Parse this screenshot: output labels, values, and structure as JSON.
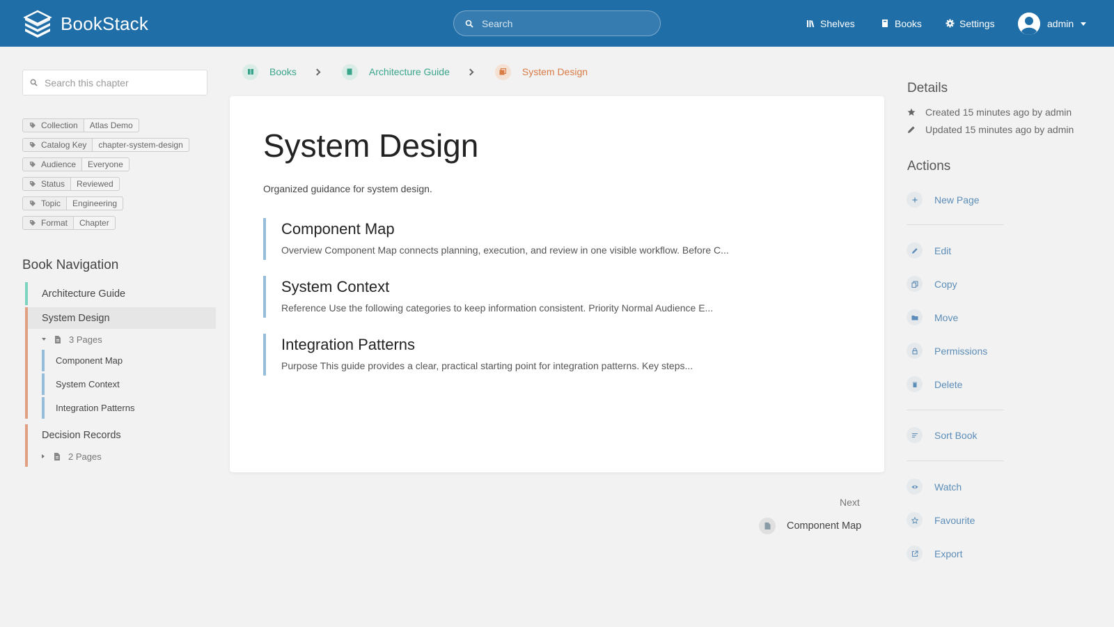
{
  "header": {
    "app_name": "BookStack",
    "search_placeholder": "Search",
    "nav": [
      {
        "label": "Shelves",
        "icon": "shelves-icon"
      },
      {
        "label": "Books",
        "icon": "book-icon"
      },
      {
        "label": "Settings",
        "icon": "gear-icon"
      }
    ],
    "user_name": "admin"
  },
  "left_sidebar": {
    "search_placeholder": "Search this chapter",
    "tags": [
      {
        "name": "Collection",
        "value": "Atlas Demo"
      },
      {
        "name": "Catalog Key",
        "value": "chapter-system-design"
      },
      {
        "name": "Audience",
        "value": "Everyone"
      },
      {
        "name": "Status",
        "value": "Reviewed"
      },
      {
        "name": "Topic",
        "value": "Engineering"
      },
      {
        "name": "Format",
        "value": "Chapter"
      }
    ],
    "book_navigation_title": "Book Navigation",
    "book": "Architecture Guide",
    "chapters": [
      {
        "name": "System Design",
        "pages_label": "3 Pages",
        "expanded": true,
        "pages": [
          "Component Map",
          "System Context",
          "Integration Patterns"
        ]
      },
      {
        "name": "Decision Records",
        "pages_label": "2 Pages",
        "expanded": false,
        "pages": []
      }
    ]
  },
  "breadcrumb": [
    {
      "label": "Books",
      "color": "#3aa58a"
    },
    {
      "label": "Architecture Guide",
      "color": "#3aa58a"
    },
    {
      "label": "System Design",
      "color": "#d97b45"
    }
  ],
  "main": {
    "title": "System Design",
    "description": "Organized guidance for system design.",
    "pages": [
      {
        "title": "Component Map",
        "excerpt": "Overview Component Map connects planning, execution, and review in one visible workflow. Before C..."
      },
      {
        "title": "System Context",
        "excerpt": "Reference Use the following categories to keep information consistent. Priority Normal Audience E..."
      },
      {
        "title": "Integration Patterns",
        "excerpt": "Purpose This guide provides a clear, practical starting point for integration patterns. Key steps..."
      }
    ],
    "next_label": "Next",
    "next_page": "Component Map"
  },
  "right_sidebar": {
    "details_title": "Details",
    "created": "Created 15 minutes ago by admin",
    "updated": "Updated 15 minutes ago by admin",
    "actions_title": "Actions",
    "actions": {
      "new_page": "New Page",
      "edit": "Edit",
      "copy": "Copy",
      "move": "Move",
      "permissions": "Permissions",
      "delete": "Delete",
      "sort_book": "Sort Book",
      "watch": "Watch",
      "favourite": "Favourite",
      "export": "Export"
    }
  },
  "colors": {
    "header": "#206ea7",
    "book": "#3aa58a",
    "chapter": "#d97b45",
    "page": "#95bcd8",
    "link": "#5c8db8"
  }
}
